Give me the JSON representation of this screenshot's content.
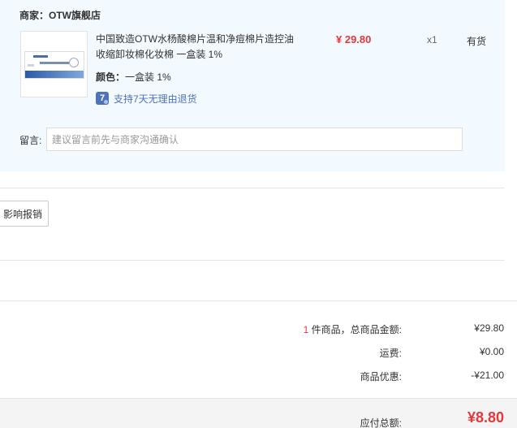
{
  "merchant": {
    "label": "商家：",
    "shop_name": "OTW旗舰店"
  },
  "product": {
    "name": "中国致造OTW水杨酸棉片温和净痘棉片造控油收缩卸妆棉化妆棉 一盒装 1%",
    "color_label": "颜色：",
    "color_value": "一盒装 1%",
    "return_icon_text": "7",
    "return_text": "支持7天无理由退货",
    "price": "¥ 29.80",
    "quantity": "x1",
    "stock": "有货"
  },
  "remark": {
    "label": "留言:",
    "placeholder": "建议留言前先与商家沟通确认",
    "value": ""
  },
  "invoice": {
    "button_label": "影响报销"
  },
  "summary": {
    "count": "1",
    "goods_total_label": " 件商品，总商品金额:",
    "goods_total_value": "¥29.80",
    "shipping_label": "运费:",
    "shipping_value": "¥0.00",
    "discount_label": "商品优惠:",
    "discount_value": "-¥21.00",
    "payable_label": "应付总额:",
    "payable_value": "¥8.80"
  },
  "colors": {
    "accent_red": "#e4393c",
    "merchant_bg": "#f2f9ff",
    "link_blue": "#4f72b8"
  }
}
